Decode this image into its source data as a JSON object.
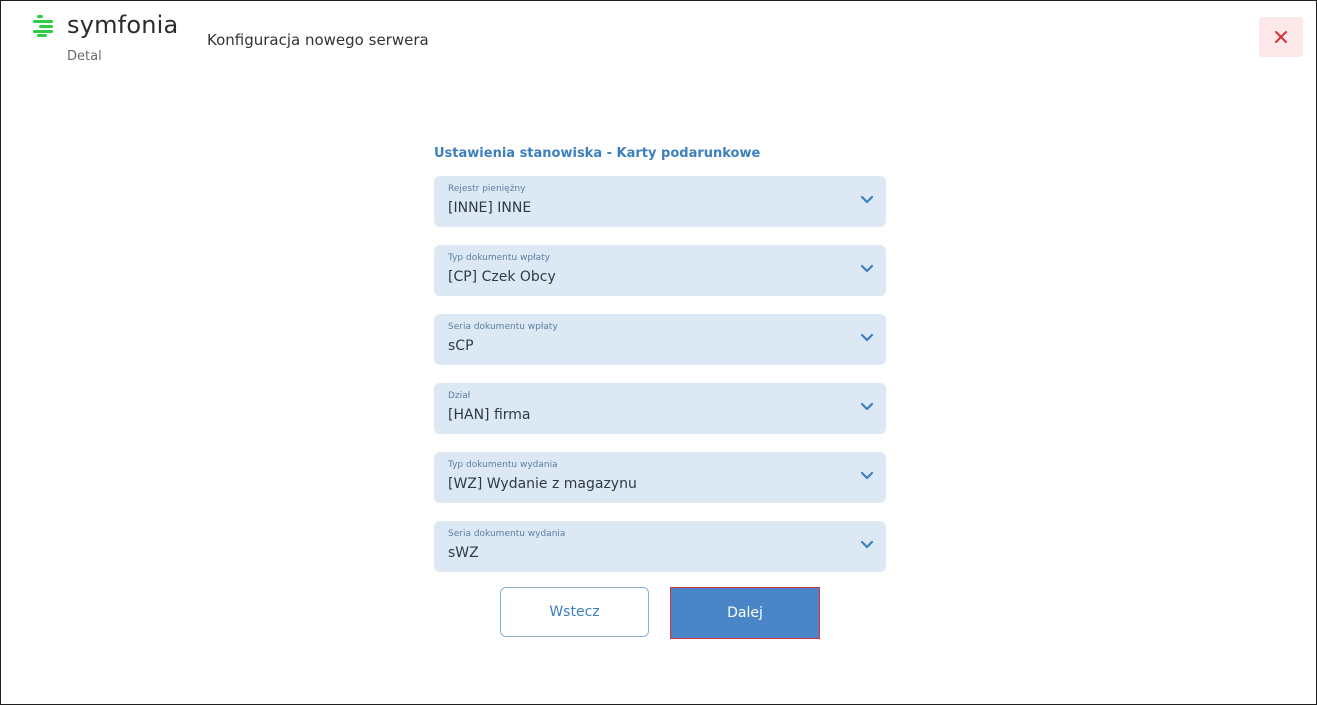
{
  "app": {
    "logo_text": "symfonia",
    "logo_sub": "Detal",
    "title": "Konfiguracja nowego serwera",
    "accent_color": "#3d7fbf",
    "brand_color": "#2ecc40"
  },
  "header": {
    "close_icon": "close-icon"
  },
  "form": {
    "title": "Ustawienia stanowiska - Karty podarunkowe",
    "fields": [
      {
        "label": "Rejestr pieniężny",
        "value": "[INNE] INNE"
      },
      {
        "label": "Typ dokumentu wpłaty",
        "value": "[CP] Czek Obcy"
      },
      {
        "label": "Seria dokumentu wpłaty",
        "value": "sCP"
      },
      {
        "label": "Dział",
        "value": "[HAN] firma"
      },
      {
        "label": "Typ dokumentu wydania",
        "value": "[WZ] Wydanie z magazynu"
      },
      {
        "label": "Seria dokumentu wydania",
        "value": "sWZ"
      }
    ]
  },
  "buttons": {
    "back_label": "Wstecz",
    "next_label": "Dalej"
  }
}
